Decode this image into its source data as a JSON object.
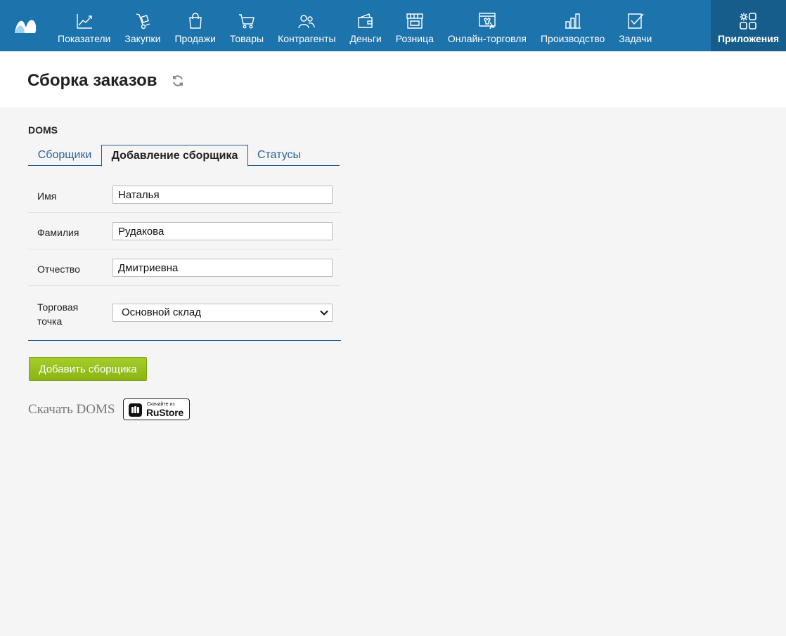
{
  "nav": {
    "items": [
      {
        "label": "Показатели",
        "icon": "chart-line-icon"
      },
      {
        "label": "Закупки",
        "icon": "hand-truck-icon"
      },
      {
        "label": "Продажи",
        "icon": "shopping-bag-icon"
      },
      {
        "label": "Товары",
        "icon": "cart-icon"
      },
      {
        "label": "Контрагенты",
        "icon": "people-icon"
      },
      {
        "label": "Деньги",
        "icon": "wallet-icon"
      },
      {
        "label": "Розница",
        "icon": "storefront-icon"
      },
      {
        "label": "Онлайн-торговля",
        "icon": "online-store-icon"
      },
      {
        "label": "Производство",
        "icon": "factory-icon"
      },
      {
        "label": "Задачи",
        "icon": "checkbox-icon"
      }
    ],
    "active": {
      "label": "Приложения",
      "icon": "apps-gear-icon"
    }
  },
  "header": {
    "title": "Сборка заказов"
  },
  "section": {
    "label": "DOMS"
  },
  "tabs": [
    {
      "label": "Сборщики"
    },
    {
      "label": "Добавление сборщика"
    },
    {
      "label": "Статусы"
    }
  ],
  "form": {
    "first_name": {
      "label": "Имя",
      "value": "Наталья"
    },
    "last_name": {
      "label": "Фамилия",
      "value": "Рудакова"
    },
    "patronymic": {
      "label": "Отчество",
      "value": "Дмитриевна"
    },
    "store": {
      "label": "Торговая точка",
      "value": "Основной склад"
    }
  },
  "actions": {
    "add_label": "Добавить сборщика"
  },
  "download": {
    "label": "Скачать DOMS",
    "badge_small": "Скачайте из",
    "badge_big": "RuStore"
  },
  "colors": {
    "nav_bg": "#1d73ab",
    "nav_active": "#165d8c",
    "button": "#95bf1b",
    "accent_line": "#1d5f94"
  }
}
